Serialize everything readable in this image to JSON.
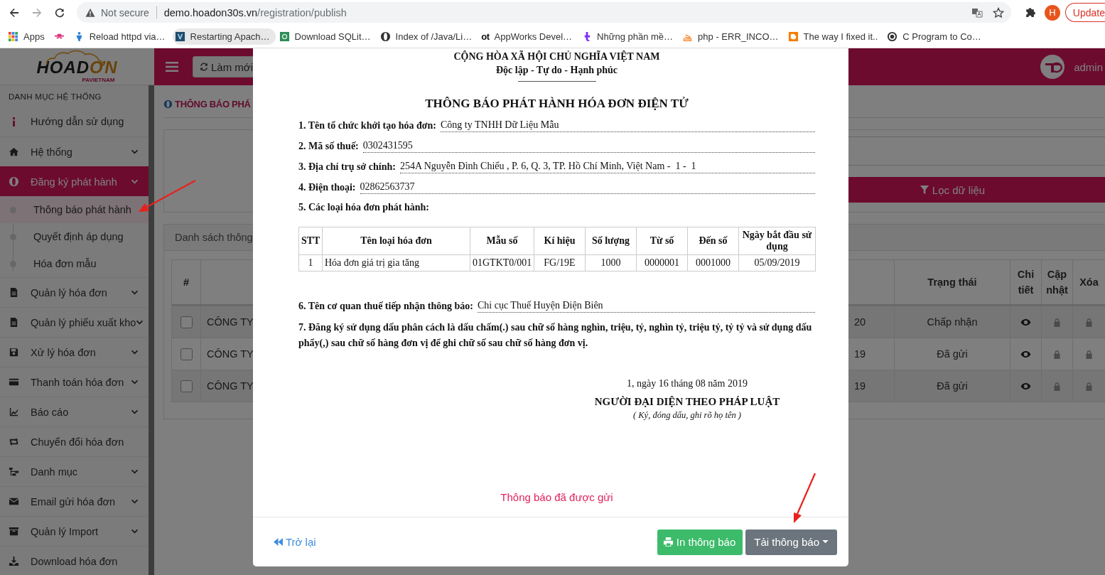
{
  "browser": {
    "security_label": "Not secure",
    "url_host": "demo.hoadon30s.vn",
    "url_path": "/registration/publish",
    "profile_initial": "H",
    "update_label": "Update",
    "bookmarks": [
      {
        "label": "Apps",
        "hovered": false
      },
      {
        "hovered": false
      },
      {
        "label": "Reload httpd via…",
        "hovered": false
      },
      {
        "label": "Restarting Apach…",
        "hovered": true
      },
      {
        "label": "Download SQLit…",
        "hovered": false
      },
      {
        "label": "Index of /Java/Li…",
        "hovered": false
      },
      {
        "icon_text": "ot",
        "label": "AppWorks Devel…",
        "hovered": false
      },
      {
        "label": "Những phần mề…",
        "hovered": false
      },
      {
        "label": "php - ERR_INCO…",
        "hovered": false
      },
      {
        "label": "The way I fixed it..",
        "hovered": false
      },
      {
        "label": "C Program to Co…",
        "hovered": false
      }
    ]
  },
  "app": {
    "logo": {
      "text_dark": "HOAD",
      "text_accent": "ƠN",
      "tagline": "PAVIETNAM"
    },
    "topbar": {
      "refresh_label": "Làm mới",
      "user": "admin"
    },
    "sidebar": {
      "heading": "DANH MỤC HỆ THỐNG",
      "items": [
        {
          "label": "Hướng dẫn sử dụng",
          "expandable": false,
          "selected": false
        },
        {
          "label": "Hệ thống",
          "expandable": true,
          "selected": false
        },
        {
          "label": "Đăng ký phát hành",
          "expandable": true,
          "selected": true,
          "children": [
            {
              "label": "Thông báo phát hành",
              "selected": true
            },
            {
              "label": "Quyết định áp dụng",
              "selected": false
            },
            {
              "label": "Hóa đơn mẫu",
              "selected": false
            }
          ]
        },
        {
          "label": "Quản lý hóa đơn",
          "expandable": true,
          "selected": false
        },
        {
          "label": "Quản lý phiếu xuất kho",
          "expandable": true,
          "selected": false
        },
        {
          "label": "Xử lý hóa đơn",
          "expandable": true,
          "selected": false
        },
        {
          "label": "Thanh toán hóa đơn",
          "expandable": true,
          "selected": false
        },
        {
          "label": "Báo cáo",
          "expandable": true,
          "selected": false
        },
        {
          "label": "Chuyển đổi hóa đơn",
          "expandable": false,
          "selected": false
        },
        {
          "label": "Danh mục",
          "expandable": true,
          "selected": false
        },
        {
          "label": "Email gửi hóa đơn",
          "expandable": true,
          "selected": false
        },
        {
          "label": "Quản lý Import",
          "expandable": true,
          "selected": false
        },
        {
          "label": "Download hóa đơn",
          "expandable": false,
          "selected": false
        }
      ]
    },
    "page": {
      "title": "THÔNG BÁO PHÁ",
      "filter_button": "Lọc dữ liệu",
      "list_tab": "Danh sách thông",
      "table": {
        "header": {
          "index": "#",
          "status": "Trạng thái",
          "detail": "Chi tiết",
          "update": "Cập nhật",
          "delete": "Xóa"
        },
        "rows": [
          {
            "checked": false,
            "company": "CÔNG TY",
            "date": "20",
            "status": "Chấp nhận",
            "locked": true
          },
          {
            "checked": false,
            "company": "CÔNG TY",
            "date": "19",
            "status": "Đã gửi",
            "locked": true
          },
          {
            "checked": false,
            "company": "CÔNG TY",
            "date": "19",
            "status": "Đã gửi",
            "locked": true
          }
        ]
      }
    }
  },
  "dialog": {
    "header_lines": [
      "CỘNG HÒA XÃ HỘI CHỦ NGHĨA VIỆT NAM",
      "Độc lập - Tự do - Hạnh phúc"
    ],
    "title": "THÔNG BÁO PHÁT HÀNH HÓA ĐƠN ĐIỆN TỬ",
    "fields": [
      {
        "label": "1. Tên tổ chức khởi tạo hóa đơn:",
        "value": "Công ty TNHH Dữ Liệu Mẫu"
      },
      {
        "label": "2. Mã số thuế:",
        "value": "0302431595"
      },
      {
        "label": "3. Địa chỉ trụ sở chính:",
        "value": "254A Nguyễn Đình Chiểu , P. 6, Q. 3, TP. Hồ Chí Minh, Việt Nam -  1 -  1"
      },
      {
        "label": "4. Điện thoại:",
        "value": "02862563737"
      }
    ],
    "section_5": "5. Các loại hóa đơn phát hành:",
    "invoice_table": {
      "columns": [
        "STT",
        "Tên loại hóa đơn",
        "Mẫu số",
        "Kí hiệu",
        "Số lượng",
        "Từ số",
        "Đến số",
        "Ngày bắt đầu sử dụng"
      ],
      "rows": [
        [
          "1",
          "Hóa đơn giá trị gia tăng",
          "01GTKT0/001",
          "FG/19E",
          "1000",
          "0000001",
          "0001000",
          "05/09/2019"
        ]
      ]
    },
    "field_6": {
      "label": "6. Tên cơ quan thuế tiếp nhận thông báo:",
      "value": "Chi cục Thuế Huyện Điện Biên"
    },
    "clause_7": "7. Đăng ký sử dụng dấu phân cách là dấu chấm(.) sau chữ số hàng nghìn, triệu, tỷ, nghìn tỷ, triệu tỷ, tỷ tỷ và sử dụng dấu phẩy(,) sau chữ số hàng đơn vị để ghi chữ số sau chữ số hàng đơn vị.",
    "signature": {
      "date": "1, ngày 16 tháng 08 năm 2019",
      "title": "NGƯỜI ĐẠI DIỆN THEO PHÁP LUẬT",
      "note": "( Ký, đóng dấu, ghi rõ họ tên )"
    },
    "status_message": "Thông báo đã được gửi",
    "back_label": "Trở lại",
    "print_label": "In thông báo",
    "download_label": "Tải thông báo"
  }
}
